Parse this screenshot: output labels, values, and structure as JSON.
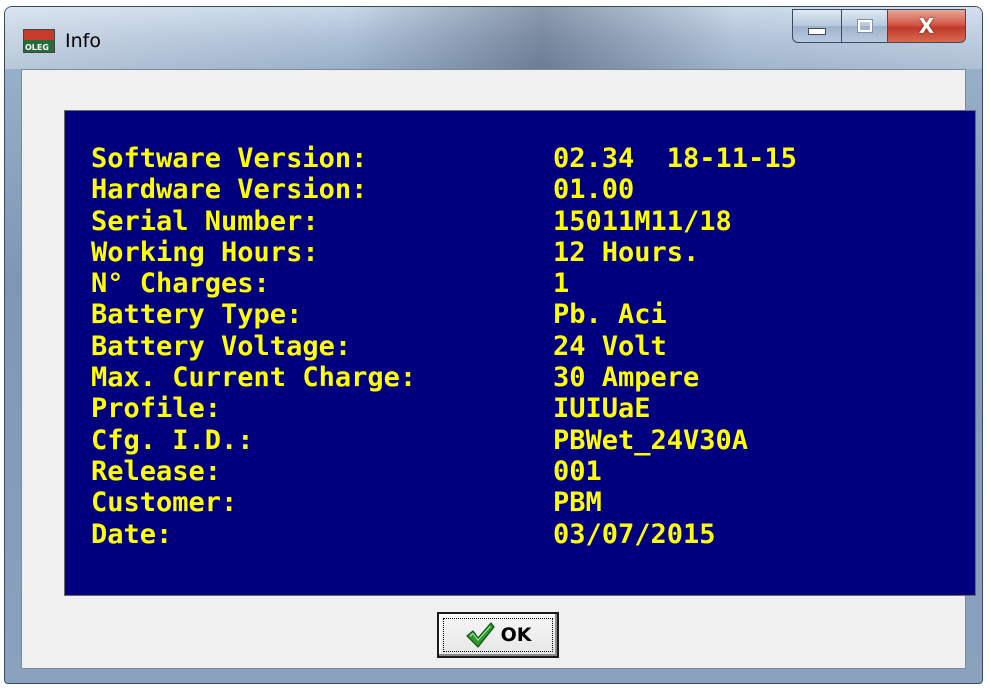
{
  "window": {
    "title": "Info",
    "app_icon": "oleg-app-icon",
    "app_icon_text": "OLEG",
    "buttons": {
      "minimize_icon": "minimize-icon",
      "maximize_icon": "maximize-icon",
      "close_icon": "close-icon",
      "close_glyph": "X"
    }
  },
  "info": {
    "rows": [
      {
        "label": "Software Version:",
        "value": "02.34  18-11-15"
      },
      {
        "label": "Hardware Version:",
        "value": "01.00"
      },
      {
        "label": "Serial Number:",
        "value": "15011M11/18"
      },
      {
        "label": "Working Hours:",
        "value": "12 Hours."
      },
      {
        "label": "N° Charges:",
        "value": "1"
      },
      {
        "label": "Battery Type:",
        "value": "Pb. Aci"
      },
      {
        "label": "Battery Voltage:",
        "value": "24 Volt"
      },
      {
        "label": "Max. Current Charge:",
        "value": "30 Ampere"
      },
      {
        "label": "Profile:",
        "value": "IUIUaE"
      },
      {
        "label": "Cfg. I.D.:",
        "value": "PBWet_24V30A"
      },
      {
        "label": "Release:",
        "value": "001"
      },
      {
        "label": "Customer:",
        "value": "PBM"
      },
      {
        "label": "Date:",
        "value": "03/07/2015"
      }
    ]
  },
  "footer": {
    "ok_label": "OK",
    "ok_icon": "checkmark-icon"
  },
  "colors": {
    "panel_background": "#00007f",
    "text": "#ffff00",
    "close_button": "#c0392b"
  }
}
